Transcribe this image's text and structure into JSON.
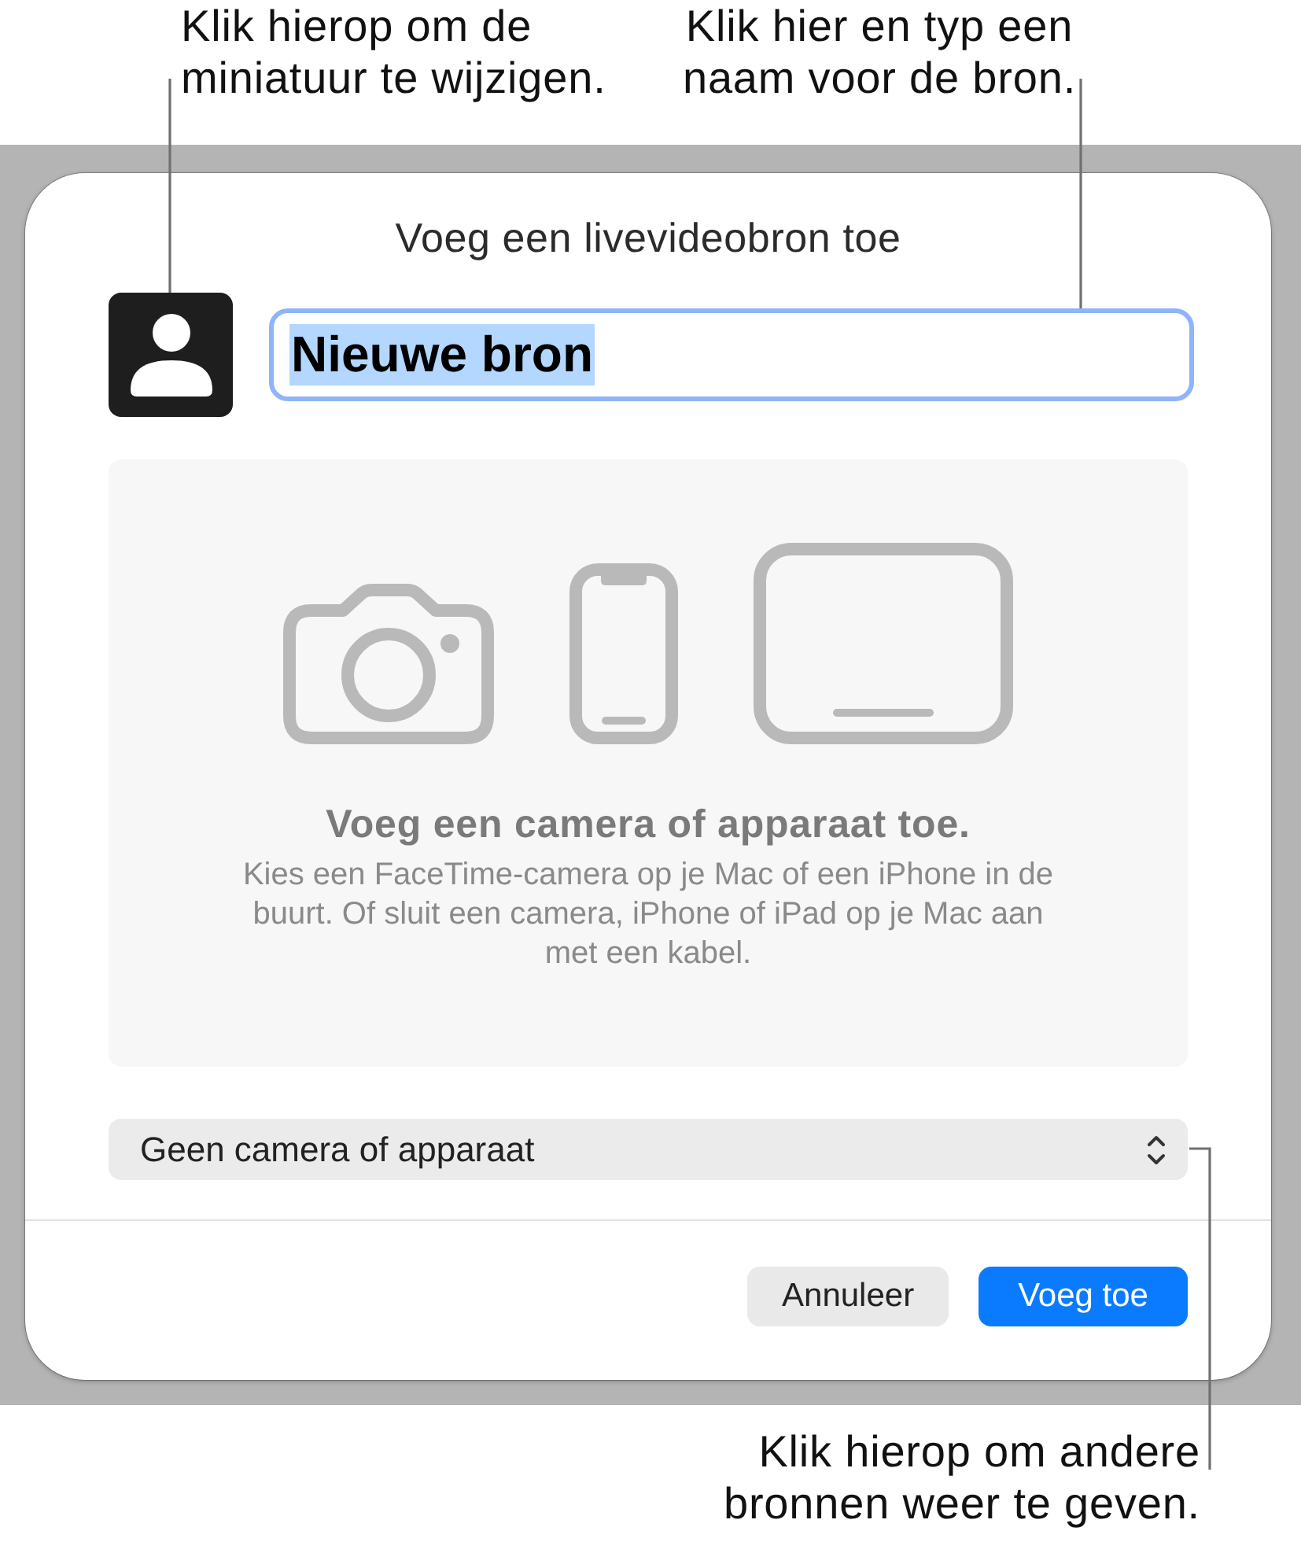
{
  "callouts": [
    {
      "text": "Klik hierop om de miniatuur te wijzigen."
    },
    {
      "text": "Klik hier en typ een naam voor de bron."
    },
    {
      "text": "Klik hierop om andere bronnen weer te geven."
    }
  ],
  "dialog": {
    "title": "Voeg een livevideobron toe",
    "name_field": {
      "value": "Nieuwe bron",
      "focused": true,
      "text_selected": true
    },
    "placeholder_panel": {
      "heading": "Voeg een camera of apparaat toe.",
      "body": "Kies een FaceTime-camera op je Mac of een iPhone in de buurt. Of sluit een camera, iPhone of iPad op je Mac aan met een kabel."
    },
    "source_select": {
      "value": "Geen camera of apparaat"
    },
    "buttons": [
      {
        "label": "Annuleer",
        "kind": "secondary"
      },
      {
        "label": "Voeg toe",
        "kind": "primary"
      }
    ]
  }
}
